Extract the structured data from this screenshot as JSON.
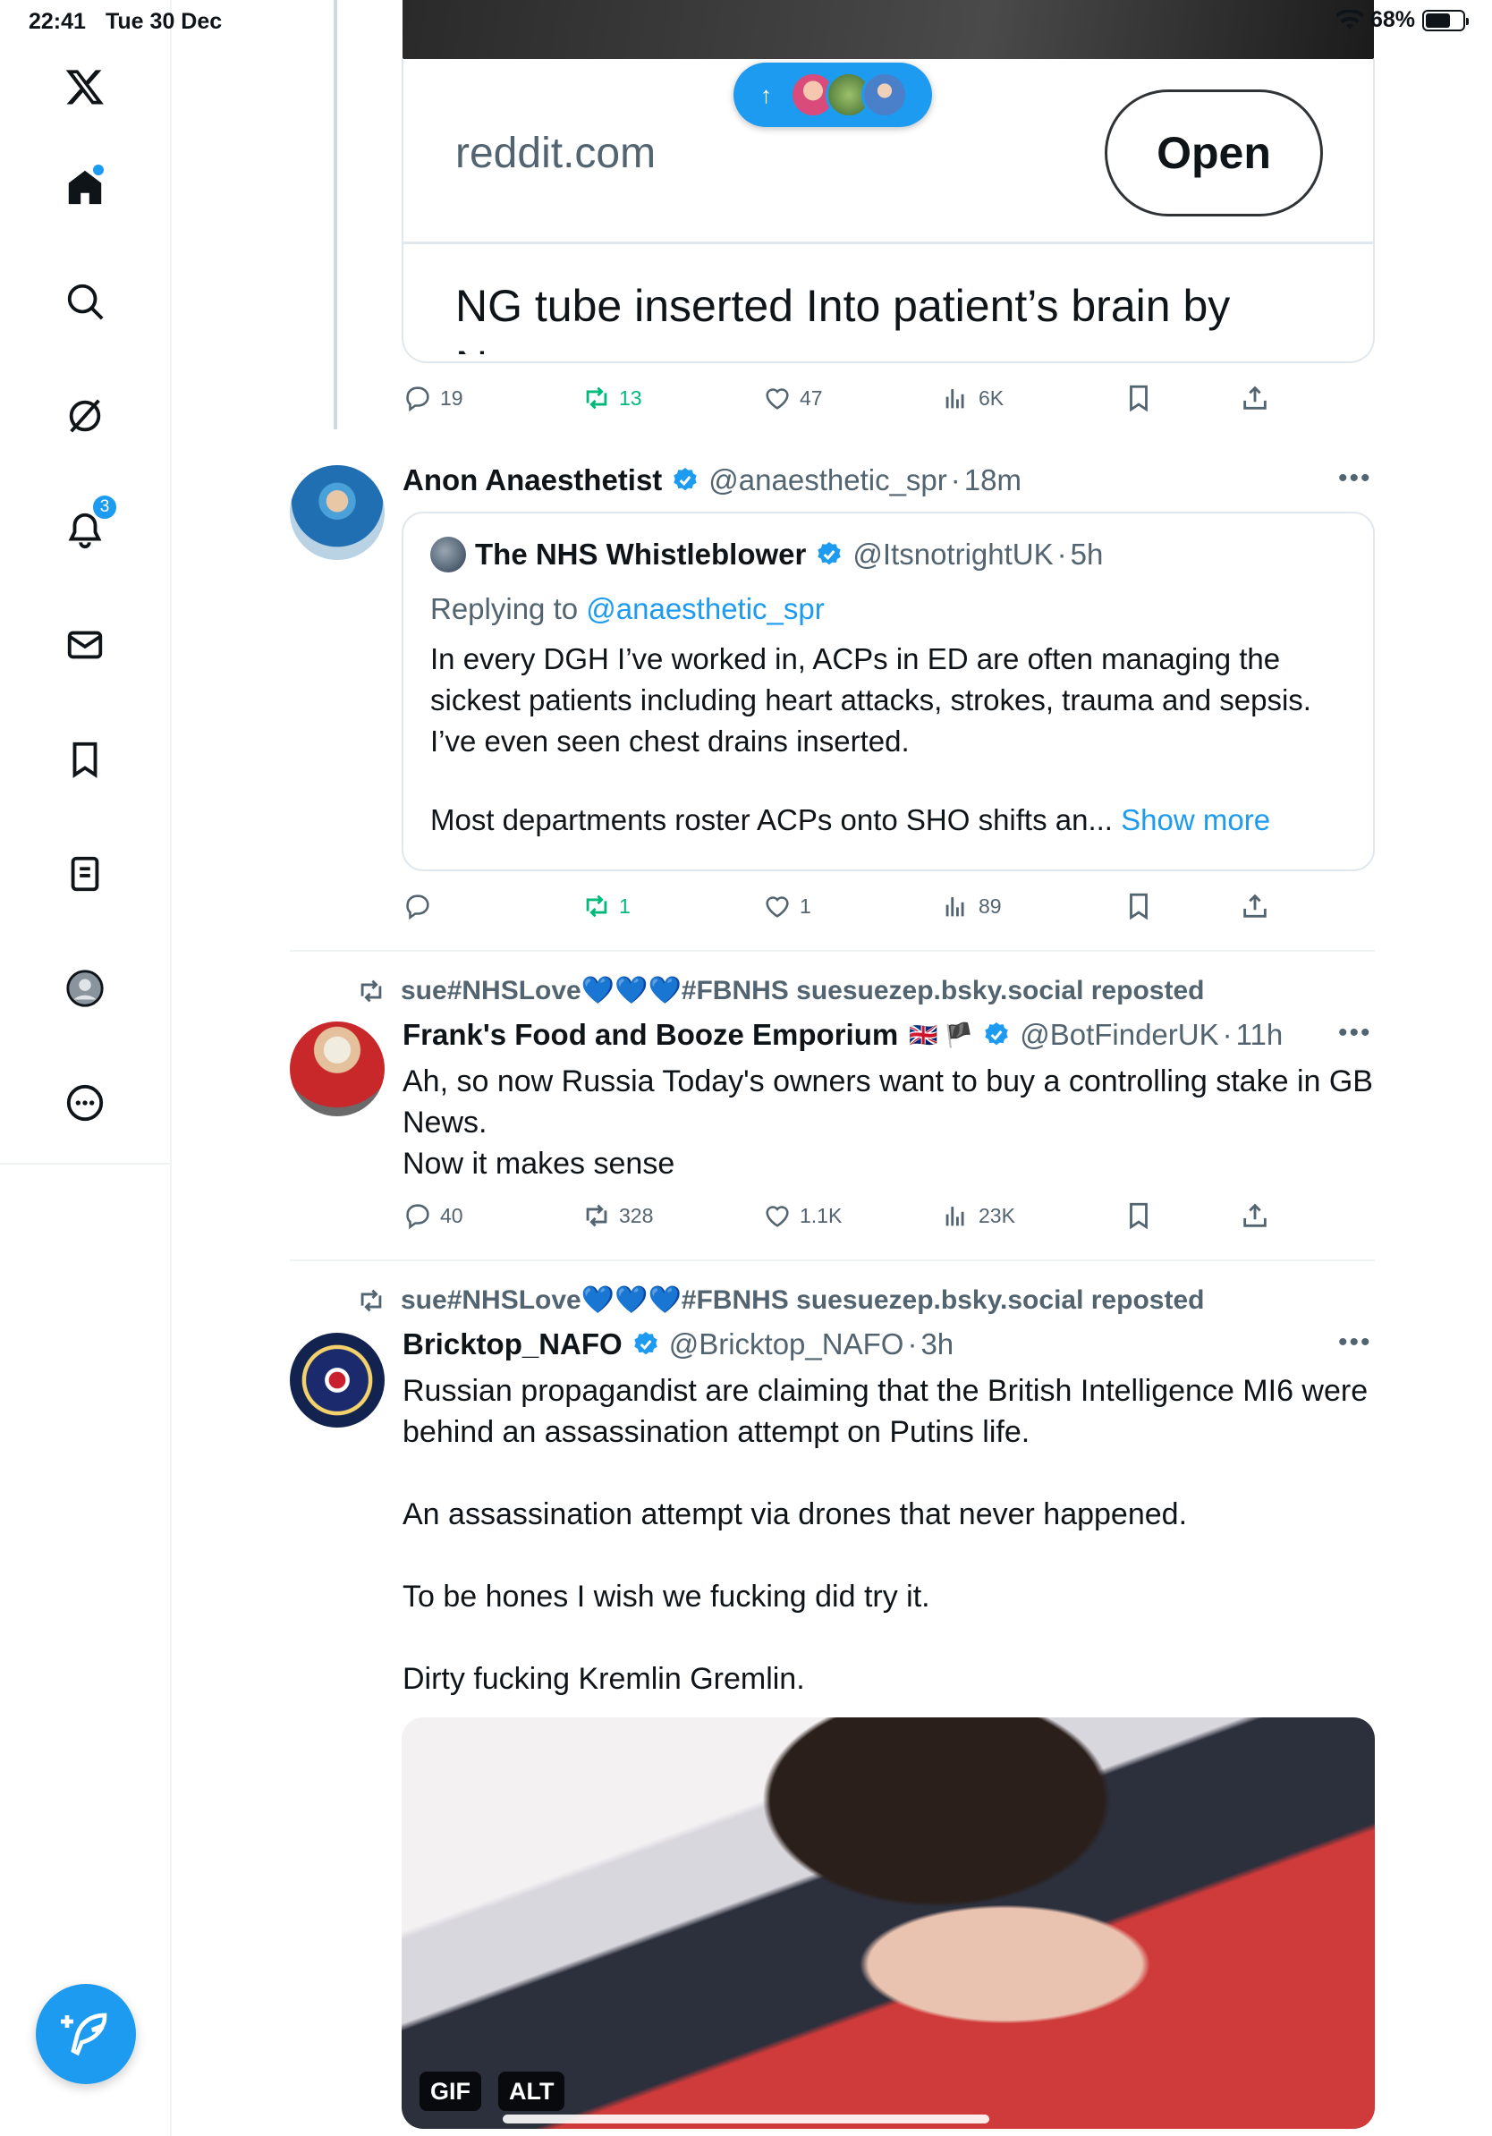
{
  "status_bar": {
    "time": "22:41",
    "date": "Tue 30 Dec",
    "battery": "68%",
    "battery_level": 0.68
  },
  "sidebar": {
    "items": [
      {
        "name": "x-logo-icon"
      },
      {
        "name": "home-icon",
        "has_dot": true
      },
      {
        "name": "search-icon"
      },
      {
        "name": "grok-icon"
      },
      {
        "name": "notifications-icon",
        "badge": "3"
      },
      {
        "name": "messages-icon"
      },
      {
        "name": "bookmarks-icon"
      },
      {
        "name": "lists-icon"
      },
      {
        "name": "profile-icon"
      },
      {
        "name": "more-icon"
      }
    ],
    "compose_icon": "compose-icon"
  },
  "colors": {
    "accent": "#1d9bf0",
    "retweet": "#00ba7c",
    "text": "#0f1419",
    "muted": "#536471"
  },
  "link_card": {
    "domain": "reddit.com",
    "open_label": "Open",
    "headline": "NG tube inserted Into patient’s brain by Nurse"
  },
  "top_actions": {
    "replies": "19",
    "reposts": "13",
    "likes": "47",
    "views": "6K"
  },
  "tweet1": {
    "name": "Anon Anaesthetist",
    "handle": "@anaesthetic_spr",
    "time": "18m",
    "quote": {
      "name": "The NHS Whistleblower",
      "handle": "@ItsnotrightUK",
      "time": "5h",
      "replying_prefix": "Replying to ",
      "replying_to": "@anaesthetic_spr",
      "text": "In every DGH I’ve worked in, ACPs in ED are often managing the sickest patients  including heart attacks, strokes, trauma and sepsis. I’ve even seen chest drains inserted.",
      "text_more": "Most  departments roster ACPs onto  SHO shifts an...",
      "show_more": "Show more"
    },
    "actions": {
      "replies": "",
      "reposts": "1",
      "likes": "1",
      "views": "89"
    }
  },
  "tweet2": {
    "reposted_by": "sue#NHSLove💙💙💙#FBNHS suesuezep.bsky.social reposted",
    "name": "Frank's Food and Booze Emporium",
    "flags": "🇬🇧 🏴",
    "handle": "@BotFinderUK",
    "time": "11h",
    "text": "Ah, so now Russia Today's owners want to buy a controlling stake in GB News.\nNow it makes sense",
    "actions": {
      "replies": "40",
      "reposts": "328",
      "likes": "1.1K",
      "views": "23K"
    }
  },
  "tweet3": {
    "reposted_by": "sue#NHSLove💙💙💙#FBNHS suesuezep.bsky.social reposted",
    "name": "Bricktop_NAFO",
    "handle": "@Bricktop_NAFO",
    "time": "3h",
    "text": "Russian propagandist are claiming that the British Intelligence MI6 were behind an assassination attempt on Putins life.\n\nAn assassination attempt via drones that never happened.\n\nTo be hones I wish we fucking did try it.\n\nDirty fucking Kremlin Gremlin.",
    "media_tags": {
      "gif": "GIF",
      "alt": "ALT"
    }
  }
}
